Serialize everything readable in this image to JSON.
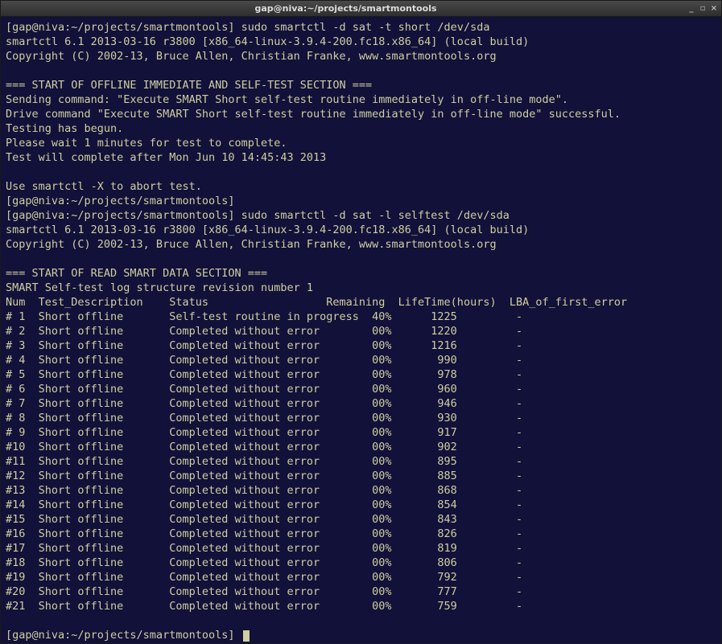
{
  "window": {
    "title": "gap@niva:~/projects/smartmontools"
  },
  "terminal": {
    "prompt1": "[gap@niva:~/projects/smartmontools] ",
    "cmd1": "sudo smartctl -d sat -t short /dev/sda",
    "ver_line": "smartctl 6.1 2013-03-16 r3800 [x86_64-linux-3.9.4-200.fc18.x86_64] (local build)",
    "copyright": "Copyright (C) 2002-13, Bruce Allen, Christian Franke, www.smartmontools.org",
    "sec1_hdr": "=== START OF OFFLINE IMMEDIATE AND SELF-TEST SECTION ===",
    "sending": "Sending command: \"Execute SMART Short self-test routine immediately in off-line mode\".",
    "drive_cmd": "Drive command \"Execute SMART Short self-test routine immediately in off-line mode\" successful.",
    "testing_begun": "Testing has begun.",
    "please_wait": "Please wait 1 minutes for test to complete.",
    "will_complete": "Test will complete after Mon Jun 10 14:45:43 2013",
    "abort": "Use smartctl -X to abort test.",
    "prompt2": "[gap@niva:~/projects/smartmontools]",
    "prompt3": "[gap@niva:~/projects/smartmontools] ",
    "cmd2": "sudo smartctl -d sat -l selftest /dev/sda",
    "sec2_hdr": "=== START OF READ SMART DATA SECTION ===",
    "log_struct": "SMART Self-test log structure revision number 1",
    "table_header": "Num  Test_Description    Status                  Remaining  LifeTime(hours)  LBA_of_first_error",
    "rows": [
      {
        "num": "# 1",
        "desc": "Short offline",
        "status": "Self-test routine in progress",
        "remaining": "40%",
        "lifetime": "1225",
        "lba": "-"
      },
      {
        "num": "# 2",
        "desc": "Short offline",
        "status": "Completed without error",
        "remaining": "00%",
        "lifetime": "1220",
        "lba": "-"
      },
      {
        "num": "# 3",
        "desc": "Short offline",
        "status": "Completed without error",
        "remaining": "00%",
        "lifetime": "1216",
        "lba": "-"
      },
      {
        "num": "# 4",
        "desc": "Short offline",
        "status": "Completed without error",
        "remaining": "00%",
        "lifetime": "990",
        "lba": "-"
      },
      {
        "num": "# 5",
        "desc": "Short offline",
        "status": "Completed without error",
        "remaining": "00%",
        "lifetime": "978",
        "lba": "-"
      },
      {
        "num": "# 6",
        "desc": "Short offline",
        "status": "Completed without error",
        "remaining": "00%",
        "lifetime": "960",
        "lba": "-"
      },
      {
        "num": "# 7",
        "desc": "Short offline",
        "status": "Completed without error",
        "remaining": "00%",
        "lifetime": "946",
        "lba": "-"
      },
      {
        "num": "# 8",
        "desc": "Short offline",
        "status": "Completed without error",
        "remaining": "00%",
        "lifetime": "930",
        "lba": "-"
      },
      {
        "num": "# 9",
        "desc": "Short offline",
        "status": "Completed without error",
        "remaining": "00%",
        "lifetime": "917",
        "lba": "-"
      },
      {
        "num": "#10",
        "desc": "Short offline",
        "status": "Completed without error",
        "remaining": "00%",
        "lifetime": "902",
        "lba": "-"
      },
      {
        "num": "#11",
        "desc": "Short offline",
        "status": "Completed without error",
        "remaining": "00%",
        "lifetime": "895",
        "lba": "-"
      },
      {
        "num": "#12",
        "desc": "Short offline",
        "status": "Completed without error",
        "remaining": "00%",
        "lifetime": "885",
        "lba": "-"
      },
      {
        "num": "#13",
        "desc": "Short offline",
        "status": "Completed without error",
        "remaining": "00%",
        "lifetime": "868",
        "lba": "-"
      },
      {
        "num": "#14",
        "desc": "Short offline",
        "status": "Completed without error",
        "remaining": "00%",
        "lifetime": "854",
        "lba": "-"
      },
      {
        "num": "#15",
        "desc": "Short offline",
        "status": "Completed without error",
        "remaining": "00%",
        "lifetime": "843",
        "lba": "-"
      },
      {
        "num": "#16",
        "desc": "Short offline",
        "status": "Completed without error",
        "remaining": "00%",
        "lifetime": "826",
        "lba": "-"
      },
      {
        "num": "#17",
        "desc": "Short offline",
        "status": "Completed without error",
        "remaining": "00%",
        "lifetime": "819",
        "lba": "-"
      },
      {
        "num": "#18",
        "desc": "Short offline",
        "status": "Completed without error",
        "remaining": "00%",
        "lifetime": "806",
        "lba": "-"
      },
      {
        "num": "#19",
        "desc": "Short offline",
        "status": "Completed without error",
        "remaining": "00%",
        "lifetime": "792",
        "lba": "-"
      },
      {
        "num": "#20",
        "desc": "Short offline",
        "status": "Completed without error",
        "remaining": "00%",
        "lifetime": "777",
        "lba": "-"
      },
      {
        "num": "#21",
        "desc": "Short offline",
        "status": "Completed without error",
        "remaining": "00%",
        "lifetime": "759",
        "lba": "-"
      }
    ],
    "prompt_final": "[gap@niva:~/projects/smartmontools] "
  }
}
